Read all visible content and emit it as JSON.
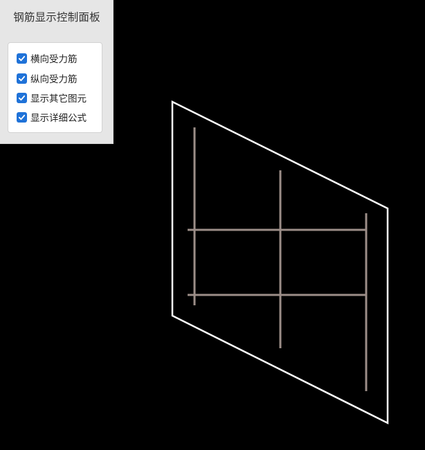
{
  "panel": {
    "title": "钢筋显示控制面板",
    "options": [
      {
        "label": "横向受力筋",
        "checked": true
      },
      {
        "label": "纵向受力筋",
        "checked": true
      },
      {
        "label": "显示其它图元",
        "checked": true
      },
      {
        "label": "显示详细公式",
        "checked": true
      }
    ]
  },
  "colors": {
    "background": "#000000",
    "slab_outline": "#ffffff",
    "rebar": "#9c8e88",
    "checkbox_accent": "#1f72d8",
    "panel_background": "#e6e6e6"
  },
  "icons": {
    "checkbox": "checkmark-icon"
  }
}
